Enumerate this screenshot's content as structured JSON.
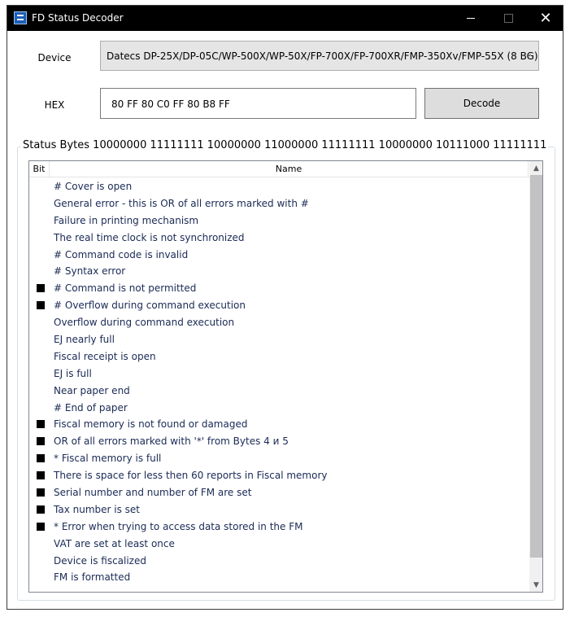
{
  "window": {
    "title": "FD Status Decoder",
    "close_glyph": "✕"
  },
  "form": {
    "device_label": "Device",
    "device_value": "Datecs DP-25X/DP-05C/WP-500X/WP-50X/FP-700X/FP-700XR/FMP-350Xv/FMP-55X (8 BG)",
    "hex_label": "HEX",
    "hex_value": "80 FF 80 C0 FF 80 B8 FF",
    "decode_label": "Decode"
  },
  "status": {
    "title": "Status Bytes 10000000 11111111 10000000 11000000 11111111 10000000 10111000 11111111"
  },
  "list": {
    "col_bit": "Bit",
    "col_name": "Name",
    "rows": [
      {
        "bit": false,
        "name": "# Cover is open"
      },
      {
        "bit": false,
        "name": "General error - this is OR of all errors marked with #"
      },
      {
        "bit": false,
        "name": "Failure in printing mechanism"
      },
      {
        "bit": false,
        "name": "The real time clock is not synchronized"
      },
      {
        "bit": false,
        "name": "# Command code is invalid"
      },
      {
        "bit": false,
        "name": "# Syntax error"
      },
      {
        "bit": true,
        "name": "# Command is not permitted"
      },
      {
        "bit": true,
        "name": "# Overflow during command execution"
      },
      {
        "bit": false,
        "name": "Overflow during command execution"
      },
      {
        "bit": false,
        "name": "EJ nearly full"
      },
      {
        "bit": false,
        "name": "Fiscal receipt is open"
      },
      {
        "bit": false,
        "name": "EJ is full"
      },
      {
        "bit": false,
        "name": "Near paper end"
      },
      {
        "bit": false,
        "name": "# End of paper"
      },
      {
        "bit": true,
        "name": "Fiscal memory is not found or damaged"
      },
      {
        "bit": true,
        "name": "OR of all errors marked with '*' from Bytes 4 и 5"
      },
      {
        "bit": true,
        "name": "* Fiscal memory is full"
      },
      {
        "bit": true,
        "name": "There is space for less then 60 reports in Fiscal memory"
      },
      {
        "bit": true,
        "name": "Serial number and number of FM are set"
      },
      {
        "bit": true,
        "name": "Tax number is set"
      },
      {
        "bit": true,
        "name": "* Error when trying to access data stored in the FM"
      },
      {
        "bit": false,
        "name": "VAT are set at least once"
      },
      {
        "bit": false,
        "name": "Device is fiscalized"
      },
      {
        "bit": false,
        "name": "FM is formatted"
      }
    ]
  }
}
